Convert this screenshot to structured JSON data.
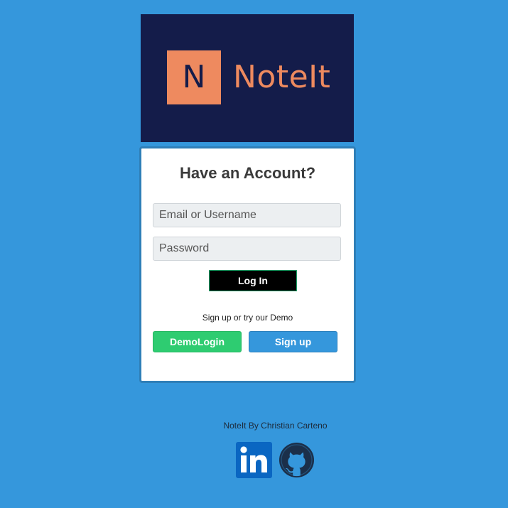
{
  "brand": {
    "logo_letter": "N",
    "name": "NoteIt",
    "banner_color": "#141c4a",
    "accent_color": "#ee8a5f"
  },
  "login": {
    "title": "Have an Account?",
    "email_placeholder": "Email or Username",
    "email_value": "",
    "password_placeholder": "Password",
    "password_value": "",
    "login_label": "Log In",
    "hint": "Sign up or try our Demo",
    "demo_label": "DemoLogin",
    "signup_label": "Sign up"
  },
  "footer": {
    "credit": "NoteIt By Christian Carteno",
    "links": [
      {
        "icon": "linkedin-icon"
      },
      {
        "icon": "github-icon"
      }
    ]
  },
  "colors": {
    "page_background": "#3597dc",
    "demo_button": "#2ecc71",
    "signup_button": "#3597dc",
    "login_button": "#000000"
  }
}
